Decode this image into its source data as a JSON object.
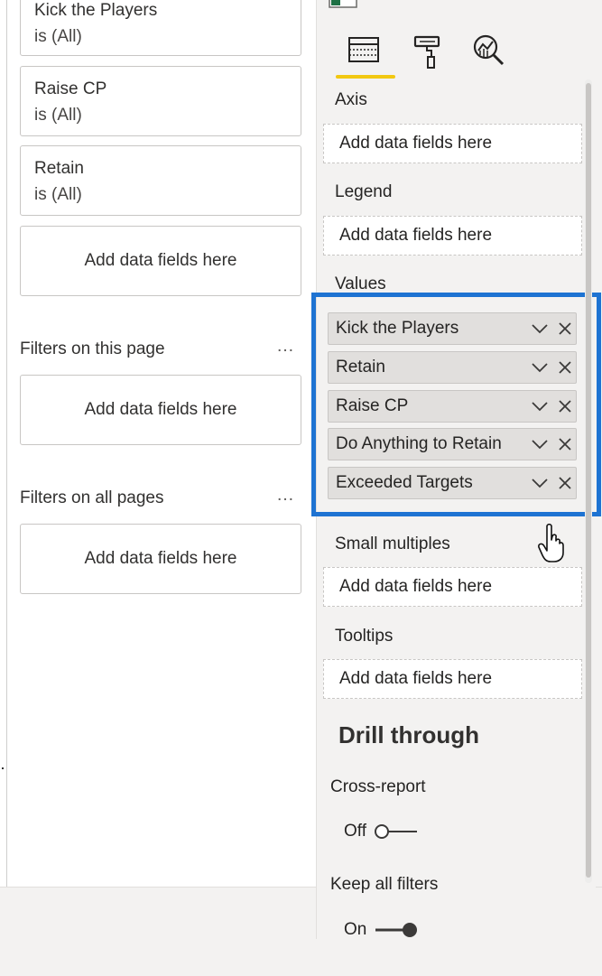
{
  "filters_pane": {
    "visual_filters": [
      {
        "name": "Kick the Players",
        "condition": "is (All)"
      },
      {
        "name": "Raise CP",
        "condition": "is (All)"
      },
      {
        "name": "Retain",
        "condition": "is (All)"
      }
    ],
    "visual_add_fields": "Add data fields here",
    "page_section_title": "Filters on this page",
    "page_add_fields": "Add data fields here",
    "all_pages_section_title": "Filters on all pages",
    "all_pages_add_fields": "Add data fields here",
    "more_options": "…"
  },
  "visualizations_pane": {
    "tabs": [
      {
        "name": "fields",
        "icon": "fields-table-icon",
        "active": true
      },
      {
        "name": "format",
        "icon": "paint-roller-icon",
        "active": false
      },
      {
        "name": "analytics",
        "icon": "analytics-magnifier-icon",
        "active": false
      }
    ],
    "accent_color": "#f2c811",
    "highlight_color": "#1e73d2",
    "axis": {
      "label": "Axis",
      "placeholder": "Add data fields here"
    },
    "legend": {
      "label": "Legend",
      "placeholder": "Add data fields here"
    },
    "values": {
      "label": "Values",
      "fields": [
        "Kick the Players",
        "Retain",
        "Raise CP",
        "Do Anything to Retain",
        "Exceeded Targets"
      ]
    },
    "small_multiples": {
      "label": "Small multiples",
      "placeholder": "Add data fields here"
    },
    "tooltips": {
      "label": "Tooltips",
      "placeholder": "Add data fields here"
    },
    "drill_through": {
      "title": "Drill through",
      "cross_report": {
        "label": "Cross-report",
        "state_text": "Off",
        "on": false
      },
      "keep_all_filters": {
        "label": "Keep all filters",
        "state_text": "On",
        "on": true
      }
    }
  }
}
